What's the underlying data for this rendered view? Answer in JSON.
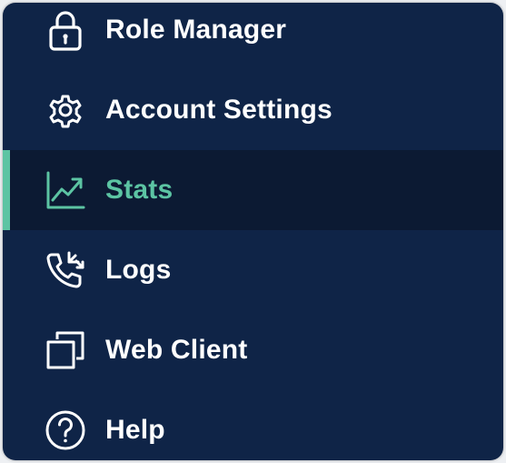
{
  "menu": {
    "items": [
      {
        "label": "Role Manager",
        "icon": "lock-icon",
        "active": false
      },
      {
        "label": "Account Settings",
        "icon": "gear-icon",
        "active": false
      },
      {
        "label": "Stats",
        "icon": "trending-chart-icon",
        "active": true
      },
      {
        "label": "Logs",
        "icon": "phone-calls-icon",
        "active": false
      },
      {
        "label": "Web Client",
        "icon": "copy-windows-icon",
        "active": false
      },
      {
        "label": "Help",
        "icon": "question-circle-icon",
        "active": false
      }
    ]
  },
  "colors": {
    "menu_background": "#0f2447",
    "active_background": "#0c1a33",
    "accent": "#5cc4a3",
    "text": "#ffffff"
  }
}
